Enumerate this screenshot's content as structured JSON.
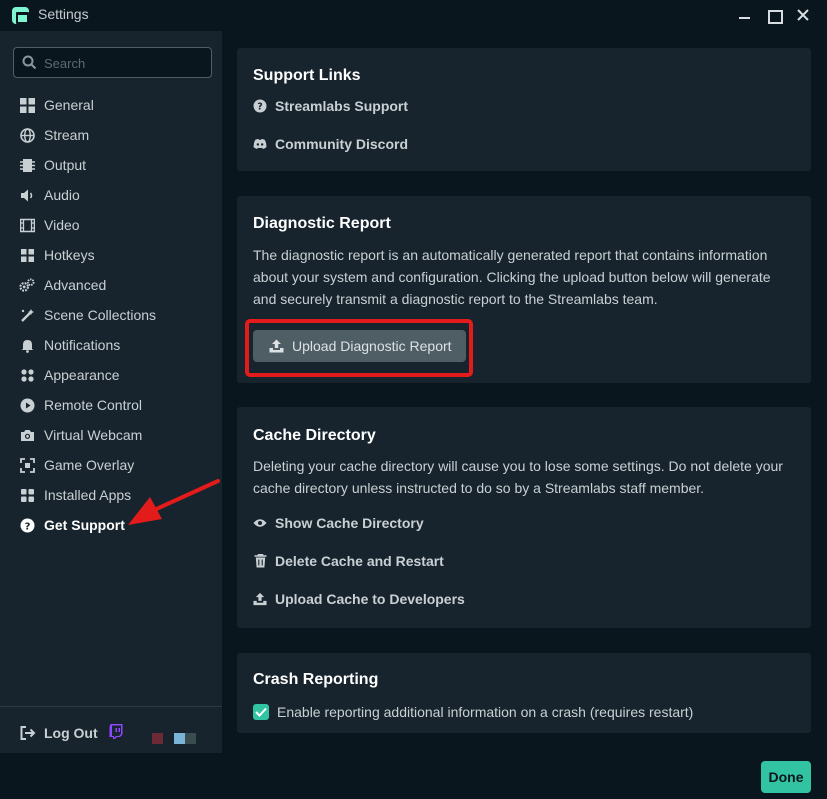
{
  "window": {
    "title": "Settings"
  },
  "sidebar": {
    "search_placeholder": "Search",
    "items": [
      {
        "label": "General",
        "icon": "grid-icon"
      },
      {
        "label": "Stream",
        "icon": "globe-icon"
      },
      {
        "label": "Output",
        "icon": "chip-icon"
      },
      {
        "label": "Audio",
        "icon": "speaker-icon"
      },
      {
        "label": "Video",
        "icon": "film-icon"
      },
      {
        "label": "Hotkeys",
        "icon": "keyboard-grid-icon"
      },
      {
        "label": "Advanced",
        "icon": "gears-icon"
      },
      {
        "label": "Scene Collections",
        "icon": "wand-icon"
      },
      {
        "label": "Notifications",
        "icon": "bell-icon"
      },
      {
        "label": "Appearance",
        "icon": "palette-icon"
      },
      {
        "label": "Remote Control",
        "icon": "play-circle-icon"
      },
      {
        "label": "Virtual Webcam",
        "icon": "camera-icon"
      },
      {
        "label": "Game Overlay",
        "icon": "overlay-icon"
      },
      {
        "label": "Installed Apps",
        "icon": "apps-icon"
      },
      {
        "label": "Get Support",
        "icon": "question-circle-icon",
        "active": true
      }
    ],
    "logout_label": "Log Out"
  },
  "support_links": {
    "title": "Support Links",
    "links": [
      {
        "label": "Streamlabs Support",
        "icon": "question-circle-icon"
      },
      {
        "label": "Community Discord",
        "icon": "discord-icon"
      }
    ]
  },
  "diagnostic": {
    "title": "Diagnostic Report",
    "description": "The diagnostic report is an automatically generated report that contains information about your system and configuration. Clicking the upload button below will generate and securely transmit a diagnostic report to the Streamlabs team.",
    "button_label": "Upload Diagnostic Report"
  },
  "cache": {
    "title": "Cache Directory",
    "description": "Deleting your cache directory will cause you to lose some settings. Do not delete your cache directory unless instructed to do so by a Streamlabs staff member.",
    "actions": [
      {
        "label": "Show Cache Directory",
        "icon": "eye-icon"
      },
      {
        "label": "Delete Cache and Restart",
        "icon": "trash-icon"
      },
      {
        "label": "Upload Cache to Developers",
        "icon": "upload-icon"
      }
    ]
  },
  "crash": {
    "title": "Crash Reporting",
    "checkbox_label": "Enable reporting additional information on a crash (requires restart)",
    "checked": true
  },
  "footer": {
    "done_label": "Done"
  },
  "colors": {
    "accent": "#31c3a2",
    "highlight": "#e31b1b",
    "background": "#09161d",
    "panel": "#17242d"
  }
}
